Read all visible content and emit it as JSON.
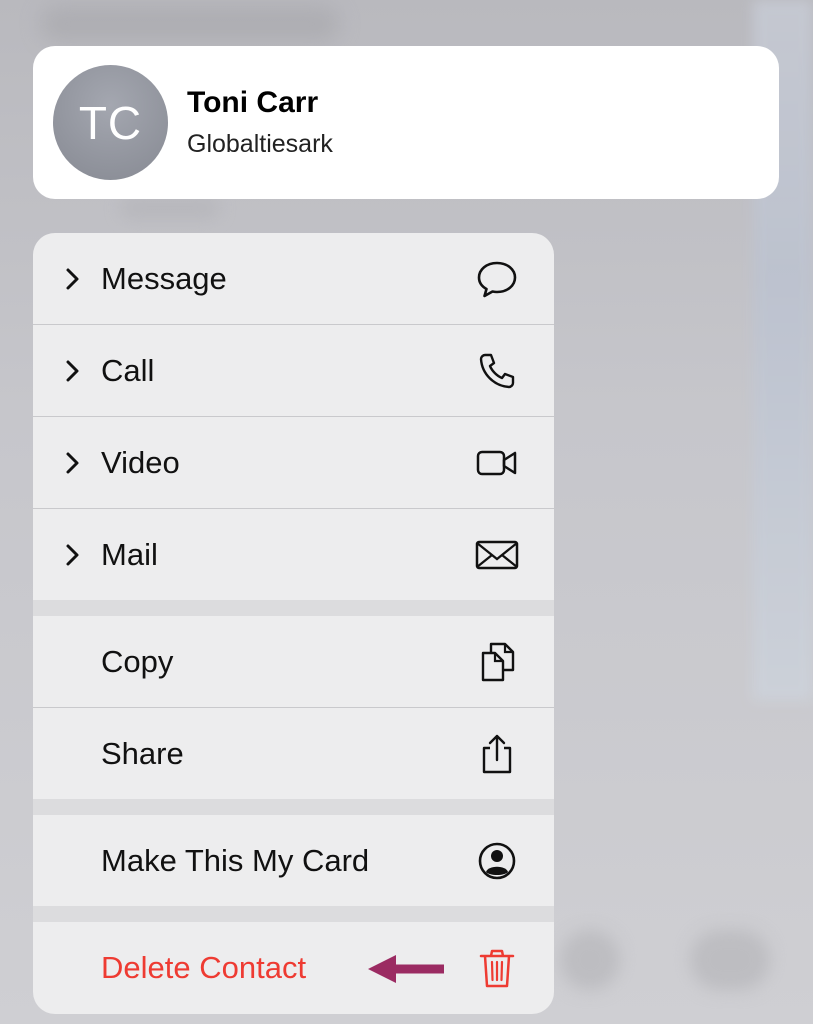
{
  "contact": {
    "initials": "TC",
    "name": "Toni Carr",
    "subtitle": "Globaltiesark"
  },
  "menu": {
    "message": "Message",
    "call": "Call",
    "video": "Video",
    "mail": "Mail",
    "copy": "Copy",
    "share": "Share",
    "make_card": "Make This My Card",
    "delete": "Delete Contact"
  },
  "colors": {
    "danger": "#ee3b32",
    "annotation_arrow": "#9b2b62"
  },
  "icons": [
    "speech-bubble-icon",
    "phone-icon",
    "video-camera-icon",
    "envelope-icon",
    "copy-documents-icon",
    "share-icon",
    "person-circle-icon",
    "trash-icon",
    "arrow-left-icon"
  ]
}
